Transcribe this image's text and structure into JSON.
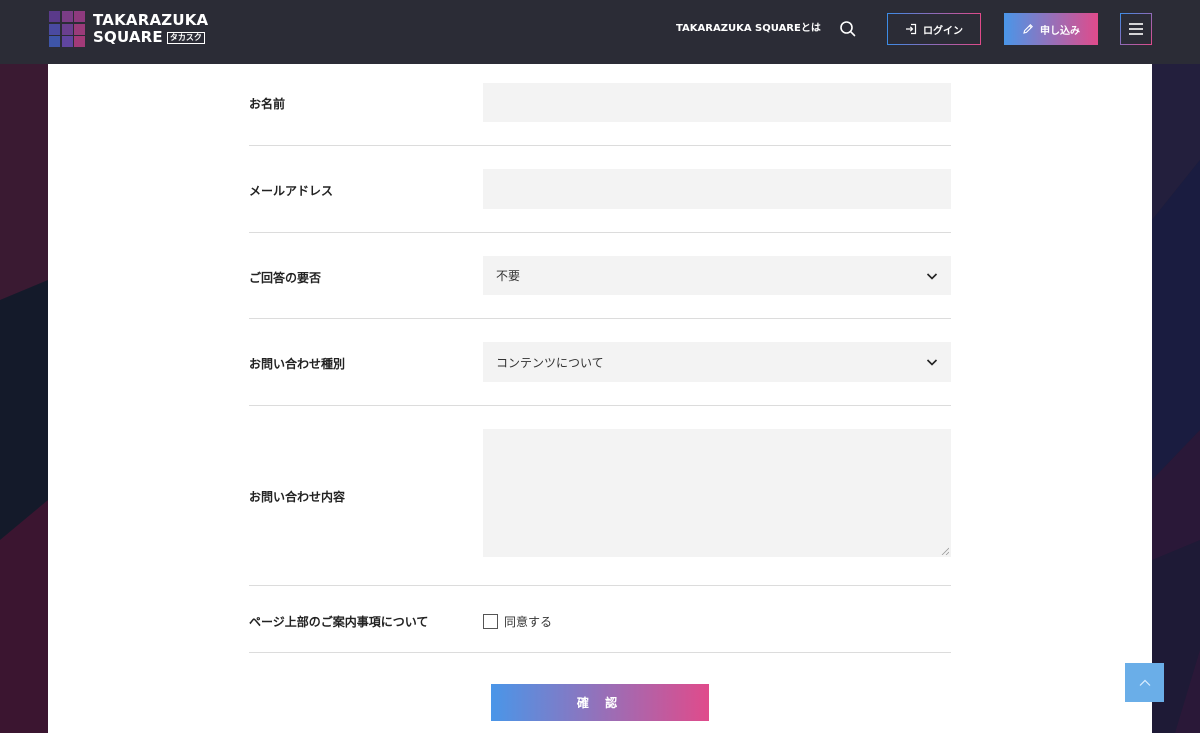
{
  "header": {
    "logo": {
      "line1": "TAKARAZUKA",
      "line2": "SQUARE",
      "badge": "タカスク"
    },
    "nav_about": "TAKARAZUKA SQUAREとは",
    "search_icon": "search-icon",
    "login_label": "ログイン",
    "apply_label": "申し込み",
    "menu_icon": "hamburger-menu-icon"
  },
  "form": {
    "name": {
      "label": "お名前",
      "value": ""
    },
    "email": {
      "label": "メールアドレス",
      "value": ""
    },
    "reply": {
      "label": "ご回答の要否",
      "selected": "不要"
    },
    "inquiry_type": {
      "label": "お問い合わせ種別",
      "selected": "コンテンツについて"
    },
    "inquiry_body": {
      "label": "お問い合わせ内容",
      "value": ""
    },
    "agreement": {
      "label": "ページ上部のご案内事項について",
      "checkbox_label": "同意する",
      "checked": false
    },
    "confirm_label": "確 認"
  },
  "colors": {
    "header_bg": "#2b2c36",
    "gradient_start": "#4a96e8",
    "gradient_end": "#e04b8b",
    "field_bg": "#f3f3f3",
    "to_top_bg": "#6aaee8"
  }
}
